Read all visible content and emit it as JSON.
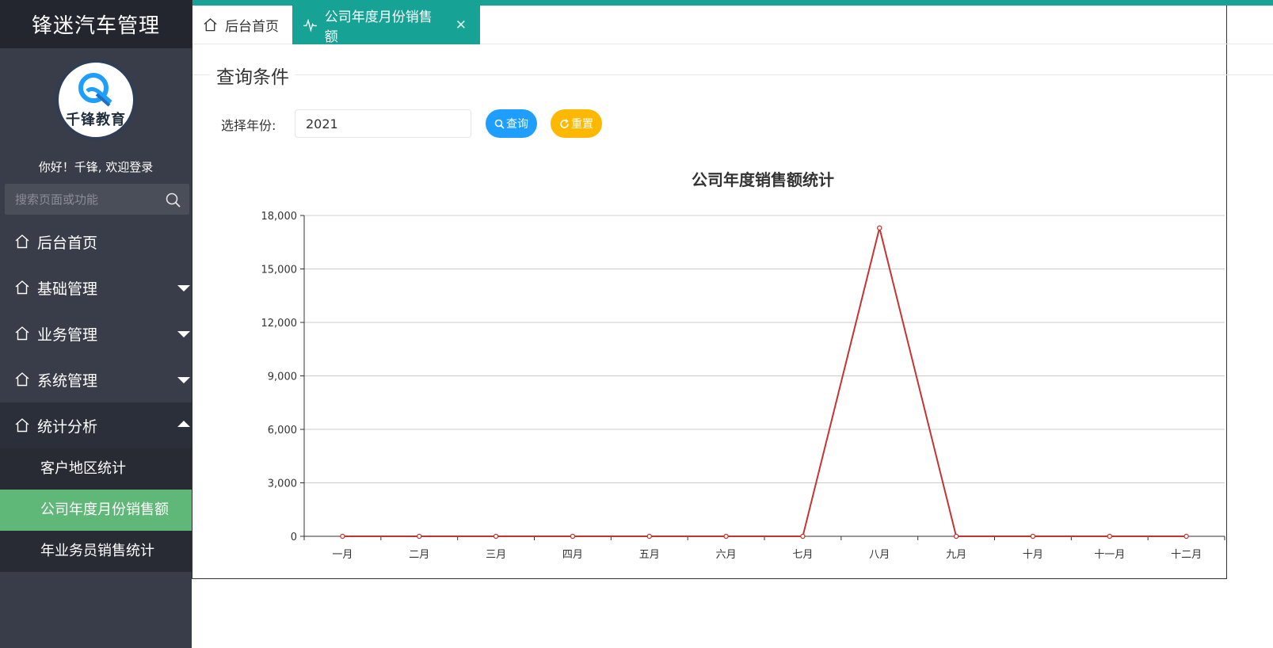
{
  "app": {
    "title": "锋迷汽车管理"
  },
  "user": {
    "welcome": "你好！千锋, 欢迎登录",
    "avatar_text": "千锋教育"
  },
  "sidebar": {
    "search_placeholder": "搜索页面或功能",
    "items": [
      {
        "label": "后台首页",
        "icon": "home-icon"
      },
      {
        "label": "基础管理",
        "icon": "home-icon",
        "expandable": true
      },
      {
        "label": "业务管理",
        "icon": "home-icon",
        "expandable": true
      },
      {
        "label": "系统管理",
        "icon": "home-icon",
        "expandable": true
      },
      {
        "label": "统计分析",
        "icon": "home-icon",
        "expandable": true,
        "open": true
      }
    ],
    "subitems": [
      {
        "label": "客户地区统计"
      },
      {
        "label": "公司年度月份销售额",
        "active": true
      },
      {
        "label": "年业务员销售统计"
      }
    ]
  },
  "tabs": [
    {
      "label": "后台首页",
      "icon": "home-icon"
    },
    {
      "label": "公司年度月份销售额",
      "icon": "pulse-icon",
      "active": true,
      "close": "✕"
    }
  ],
  "query": {
    "legend": "查询条件",
    "year_label": "选择年份:",
    "year_value": "2021",
    "search_label": "查询",
    "reset_label": "重置"
  },
  "colors": {
    "accent": "#16a295",
    "sidebar": "#393d49",
    "active_sub": "#5fb878",
    "search_btn": "#1e9fff",
    "reset_btn": "#ffb800",
    "line": "#c23531"
  },
  "chart_data": {
    "type": "line",
    "title": "公司年度销售额统计",
    "categories": [
      "一月",
      "二月",
      "三月",
      "四月",
      "五月",
      "六月",
      "七月",
      "八月",
      "九月",
      "十月",
      "十一月",
      "十二月"
    ],
    "values": [
      0,
      0,
      0,
      0,
      0,
      0,
      0,
      17300,
      0,
      0,
      0,
      0
    ],
    "ylim": [
      0,
      18000
    ],
    "yticks": [
      "0",
      "3,000",
      "6,000",
      "9,000",
      "12,000",
      "15,000",
      "18,000"
    ],
    "grid": true
  }
}
